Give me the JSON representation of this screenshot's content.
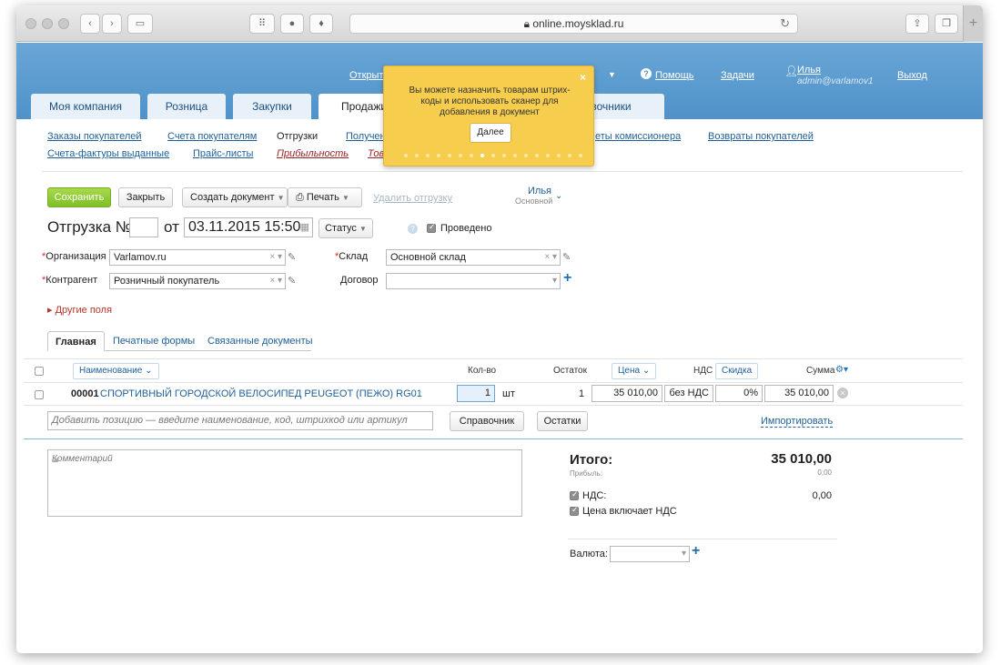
{
  "browser": {
    "url": "online.moysklad.ru",
    "lock_icon": "lock-icon"
  },
  "header": {
    "open_link": "Открыт",
    "help": "Помощь",
    "tasks": "Задачи",
    "user_name": "Илья",
    "user_email": "admin@varlamov1",
    "logout": "Выход"
  },
  "tabs": [
    {
      "label": "Моя компания"
    },
    {
      "label": "Розница"
    },
    {
      "label": "Закупки"
    },
    {
      "label": "Продажи"
    },
    {
      "label": "равочники"
    }
  ],
  "subnav": {
    "row1": [
      "Заказы покупателей",
      "Счета покупателям",
      "Отгрузки",
      "Получен",
      "еты комиссионера",
      "Возвраты покупателей"
    ],
    "row2": [
      "Счета-фактуры выданные",
      "Прайс-листы",
      "Прибыльность",
      "Тов"
    ]
  },
  "tooltip": {
    "text": "Вы можете назначить товарам штрих-коды и использовать сканер для добавления в документ",
    "next_label": "Далее",
    "close": "×"
  },
  "toolbar": {
    "save": "Сохранить",
    "close": "Закрыть",
    "create_doc": "Создать документ",
    "print": "Печать",
    "delete": "Удалить отгрузку",
    "owner_name": "Илья",
    "owner_group": "Основной"
  },
  "doc": {
    "title": "Отгрузка №",
    "number": "",
    "from": "от",
    "date": "03.11.2015 15:50",
    "status": "Статус",
    "question": "?",
    "posted": "Проведено"
  },
  "form": {
    "org_label": "Организация",
    "org_value": "Varlamov.ru",
    "warehouse_label": "Склад",
    "warehouse_value": "Основной склад",
    "counterparty_label": "Контрагент",
    "counterparty_value": "Розничный покупатель",
    "contract_label": "Договор",
    "contract_value": "",
    "other_fields": "Другие поля"
  },
  "doc_tabs": [
    "Главная",
    "Печатные формы",
    "Связанные документы"
  ],
  "table": {
    "headers": {
      "name": "Наименование",
      "qty": "Кол-во",
      "stock": "Остаток",
      "price": "Цена",
      "vat": "НДС",
      "discount": "Скидка",
      "sum": "Сумма"
    },
    "rows": [
      {
        "code": "00001",
        "name": "СПОРТИВНЫЙ ГОРОДСКОЙ ВЕЛОСИПЕД PEUGEOT (ПЕЖО) RG01",
        "qty": "1",
        "unit": "шт",
        "stock": "1",
        "price": "35 010,00",
        "vat": "без НДС",
        "discount": "0%",
        "sum": "35 010,00"
      }
    ],
    "add_placeholder": "Добавить позицию — введите наименование, код, штрихкод или артикул",
    "catalog_button": "Справочник",
    "stock_button": "Остатки",
    "import_link": "Импортировать"
  },
  "comment_placeholder": "Комментарий",
  "totals": {
    "total_label": "Итого:",
    "total_value": "35 010,00",
    "profit_label": "Прибыль:",
    "profit_value": "0,00",
    "vat_label": "НДС:",
    "vat_value": "0,00",
    "price_incl_vat": "Цена включает НДС",
    "currency_label": "Валюта:",
    "currency_value": ""
  }
}
